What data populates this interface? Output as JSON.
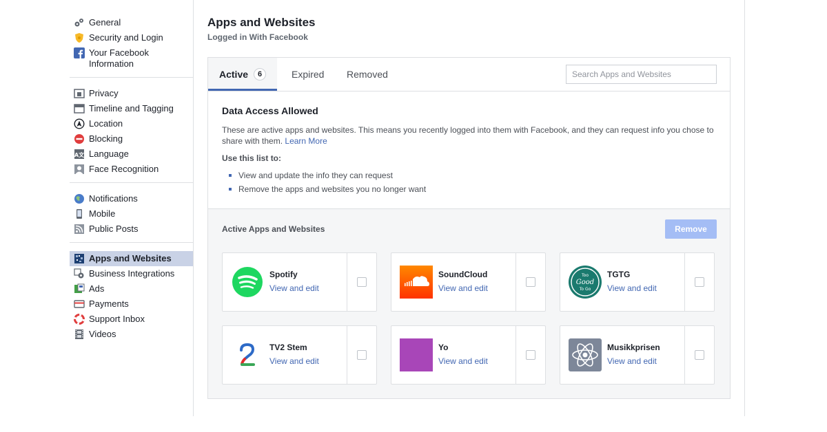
{
  "sidebar": {
    "groups": [
      [
        {
          "label": "General",
          "icon": "gears-icon"
        },
        {
          "label": "Security and Login",
          "icon": "shield-icon"
        },
        {
          "label": "Your Facebook Information",
          "icon": "facebook-icon"
        }
      ],
      [
        {
          "label": "Privacy",
          "icon": "lock-icon"
        },
        {
          "label": "Timeline and Tagging",
          "icon": "timeline-icon"
        },
        {
          "label": "Location",
          "icon": "location-icon"
        },
        {
          "label": "Blocking",
          "icon": "blocking-icon"
        },
        {
          "label": "Language",
          "icon": "language-icon"
        },
        {
          "label": "Face Recognition",
          "icon": "face-icon"
        }
      ],
      [
        {
          "label": "Notifications",
          "icon": "globe-icon"
        },
        {
          "label": "Mobile",
          "icon": "mobile-icon"
        },
        {
          "label": "Public Posts",
          "icon": "rss-icon"
        }
      ],
      [
        {
          "label": "Apps and Websites",
          "icon": "apps-icon",
          "active": true
        },
        {
          "label": "Business Integrations",
          "icon": "gear-icon"
        },
        {
          "label": "Ads",
          "icon": "ads-icon"
        },
        {
          "label": "Payments",
          "icon": "card-icon"
        },
        {
          "label": "Support Inbox",
          "icon": "lifebuoy-icon"
        },
        {
          "label": "Videos",
          "icon": "film-icon"
        }
      ]
    ]
  },
  "header": {
    "title": "Apps and Websites",
    "subtitle": "Logged in With Facebook"
  },
  "tabs": {
    "active_label": "Active",
    "active_count": "6",
    "expired_label": "Expired",
    "removed_label": "Removed"
  },
  "search": {
    "placeholder": "Search Apps and Websites"
  },
  "info": {
    "title": "Data Access Allowed",
    "description": "These are active apps and websites. This means you recently logged into them with Facebook, and they can request info you chose to share with them.",
    "learn_more": "Learn More",
    "use_label": "Use this list to:",
    "bullets": [
      "View and update the info they can request",
      "Remove the apps and websites you no longer want"
    ]
  },
  "apps_section": {
    "header": "Active Apps and Websites",
    "remove_label": "Remove",
    "link_label": "View and edit",
    "apps": [
      {
        "name": "Spotify",
        "icon": "spotify-logo-icon",
        "color": "#1ed760"
      },
      {
        "name": "SoundCloud",
        "icon": "soundcloud-logo-icon",
        "color": "#ff5500"
      },
      {
        "name": "TGTG",
        "icon": "tgtg-logo-icon",
        "color": "#1a7a6e",
        "logo_text": [
          "Too",
          "Good",
          "To Go"
        ]
      },
      {
        "name": "TV2 Stem",
        "icon": "tv2-logo-icon",
        "color": "#ffffff",
        "logo_text": "2"
      },
      {
        "name": "Yo",
        "icon": "yo-logo-icon",
        "color": "#a846b8"
      },
      {
        "name": "Musikkprisen",
        "icon": "atom-logo-icon",
        "color": "#7d8799"
      }
    ]
  },
  "colors": {
    "accent": "#4267b2",
    "active_nav": "#c9d2e6",
    "remove_disabled": "#a4bdf5"
  }
}
